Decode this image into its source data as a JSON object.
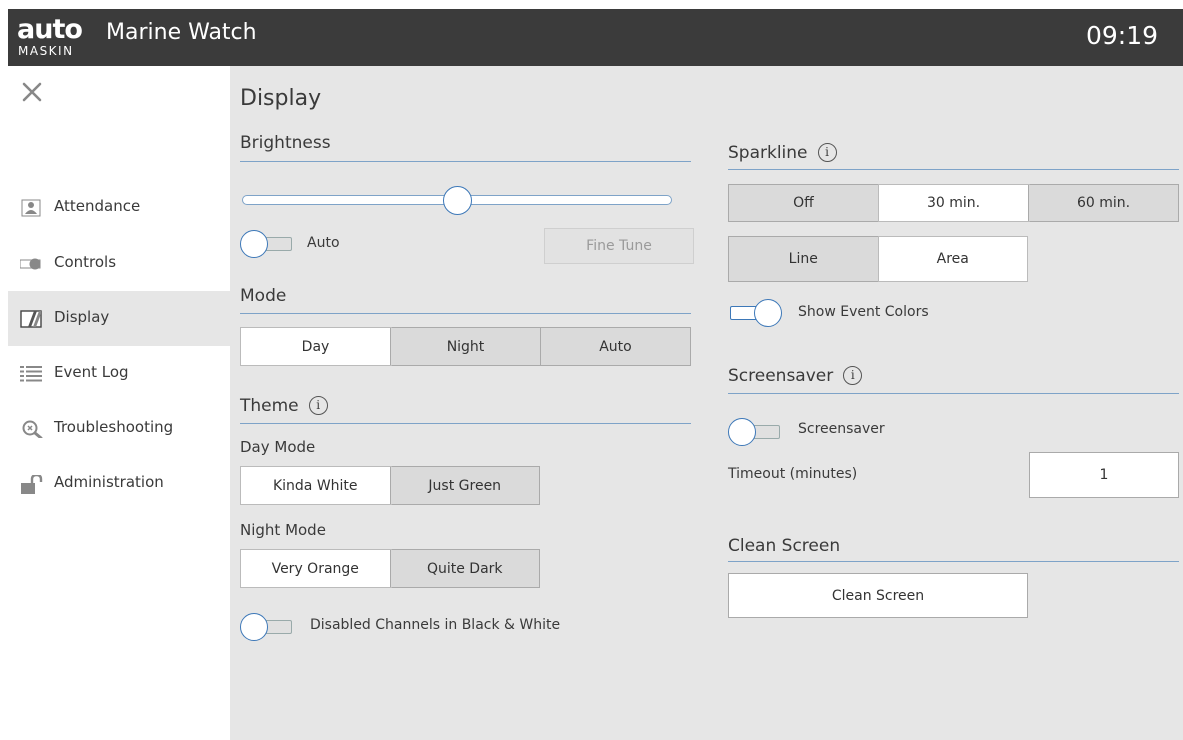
{
  "app": {
    "logo_word": "auto",
    "logo_sub": "MASKIN",
    "title": "Marine Watch",
    "clock": "09:19"
  },
  "sidebar": {
    "items": [
      {
        "label": "Attendance",
        "icon": "attendance-icon"
      },
      {
        "label": "Controls",
        "icon": "toggle-icon"
      },
      {
        "label": "Display",
        "icon": "display-icon"
      },
      {
        "label": "Event Log",
        "icon": "list-icon"
      },
      {
        "label": "Troubleshooting",
        "icon": "troubleshooting-icon"
      },
      {
        "label": "Administration",
        "icon": "padlock-open-icon"
      }
    ],
    "active": "Display"
  },
  "display": {
    "title": "Display",
    "brightness": {
      "label": "Brightness",
      "level": 0.5,
      "auto_label": "Auto",
      "auto_on": false,
      "fine_tune": "Fine Tune"
    },
    "mode": {
      "label": "Mode",
      "options": [
        "Day",
        "Night",
        "Auto"
      ],
      "selected": "Day"
    },
    "theme": {
      "label": "Theme",
      "day_mode_label": "Day Mode",
      "day_options": [
        "Kinda White",
        "Just Green"
      ],
      "day_selected": "Kinda White",
      "night_mode_label": "Night Mode",
      "night_options": [
        "Very Orange",
        "Quite Dark"
      ],
      "night_selected": "Very Orange",
      "bw_label": "Disabled Channels in Black & White",
      "bw_on": false
    },
    "sparkline": {
      "label": "Sparkline",
      "duration_options": [
        "Off",
        "30 min.",
        "60 min."
      ],
      "duration_selected": "30 min.",
      "style_options": [
        "Line",
        "Area"
      ],
      "style_selected": "Area",
      "event_colors_label": "Show Event Colors",
      "event_colors_on": true
    },
    "screensaver": {
      "label": "Screensaver",
      "toggle_label": "Screensaver",
      "toggle_on": false,
      "timeout_label": "Timeout (minutes)",
      "timeout_value": "1"
    },
    "clean_screen": {
      "label": "Clean Screen",
      "button": "Clean Screen"
    },
    "info_glyph": "i"
  },
  "colors": {
    "topbar": "#3b3b3b",
    "accent": "#3d78b8",
    "rule": "#7ea3c8",
    "panel": "#e6e6e6"
  }
}
